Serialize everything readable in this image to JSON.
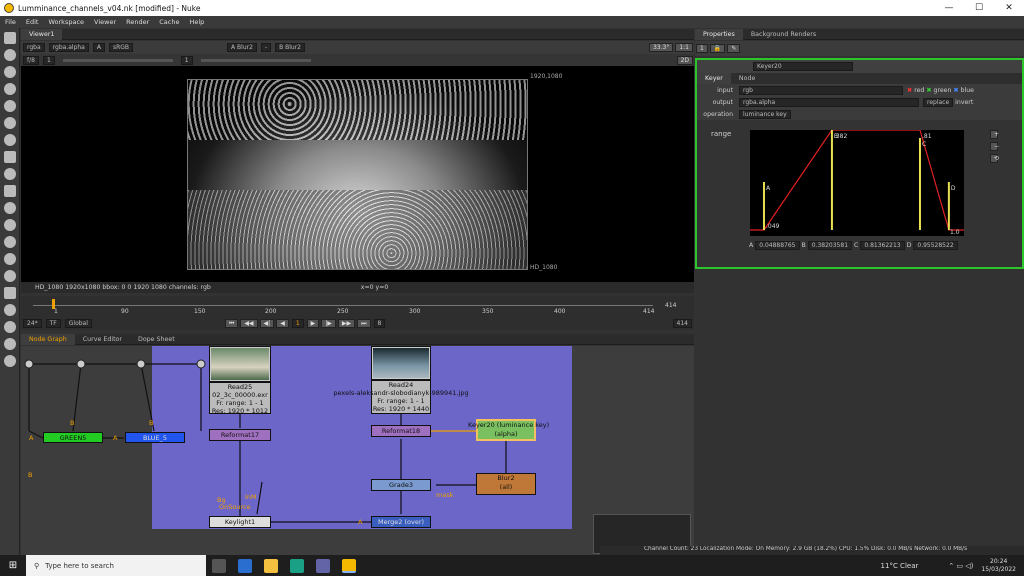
{
  "window": {
    "title": "Lumminance_channels_v04.nk [modified] - Nuke",
    "minimize": "—",
    "maximize": "☐",
    "close": "✕"
  },
  "menu": [
    "File",
    "Edit",
    "Workspace",
    "Viewer",
    "Render",
    "Cache",
    "Help"
  ],
  "viewer": {
    "tab": "Viewer1",
    "channels": "rgba",
    "channel_alpha": "rgba.alpha",
    "display": "A",
    "lut": "sRGB",
    "a_input": "A  Blur2",
    "b_input": "B  Blur2",
    "dash": "-",
    "zoom": "33.3°",
    "ratio": "1:1",
    "frame": "f/8",
    "frame_num": "1",
    "y": "1",
    "view2d": "2D",
    "format_top": "1920,1080",
    "format_bottom": "HD_1080",
    "status": "HD_1080 1920x1080  bbox: 0 0 1920 1080 channels: rgb",
    "coords": "x=0 y=0"
  },
  "timeline": {
    "ticks": [
      "1",
      "90",
      "150",
      "200",
      "250",
      "300",
      "350",
      "400",
      "414"
    ],
    "end": "414",
    "fps": "24*",
    "tf": "TF",
    "mode": "Global",
    "current": "1",
    "step": "10",
    "step2": "8",
    "end2": "414"
  },
  "graph": {
    "tabs": [
      "Node Graph",
      "Curve Editor",
      "Dope Sheet"
    ],
    "nodes": {
      "green5": "GREEN5",
      "blue5": "BLUE_5",
      "read25": [
        "Read25",
        "02_3c_00000.exr",
        "Fr. range: 1 - 1",
        "Res: 1920 * 1012"
      ],
      "read24": [
        "Read24",
        "pexels-aleksandr-slobodianyk-989941.jpg",
        "Fr. range: 1 - 1",
        "Res: 1920 * 1440"
      ],
      "reformat17": "Reformat17",
      "reformat18": "Reformat18",
      "keyer20": [
        "Keyer20 (luminance key)",
        "(alpha)"
      ],
      "grade3": "Grade3",
      "blur2": [
        "Blur2",
        "(all)"
      ],
      "keylight1": "Keylight1",
      "merge2": "Merge2 (over)",
      "mask": "mask",
      "a": "A",
      "b": "B",
      "bg": "Bg",
      "inm": "InM",
      "onsource": "OnSource"
    }
  },
  "properties": {
    "tabs": [
      "Properties",
      "Background Renders"
    ],
    "node_name": "Keyer20",
    "subtabs": [
      "Keyer",
      "Node"
    ],
    "input_label": "input",
    "input_val": "rgb",
    "red": "red",
    "green": "green",
    "blue": "blue",
    "output_label": "output",
    "output_val": "rgba.alpha",
    "op": "replace",
    "invert": "invert",
    "operation_label": "operation",
    "operation_val": "luminance key",
    "range_label": "range",
    "curve_labels": {
      "a": "A",
      "b": "B",
      "c": "C",
      "d": "D",
      "v049": ".049",
      "v382": ".382",
      "v81": ".81",
      "v1": "1.0"
    },
    "values": {
      "A": "0.04888765",
      "B": "0.38203581",
      "C": "0.81362213",
      "D": "0.95528522"
    },
    "keys": [
      "A",
      "B",
      "C",
      "D"
    ],
    "curve": {
      "A": 0.0489,
      "B": 0.382,
      "C": 0.8136,
      "D": 0.9553
    }
  },
  "status": "Channel Count: 23  Localization Mode: On  Memory: 2.9 GB (18.2%)  CPU: 1.5%  Disk: 0.0 MB/s  Network: 0.0 MB/s",
  "taskbar": {
    "search": "Type here to search",
    "weather": "11°C  Clear",
    "time": "20:24",
    "date": "15/03/2022"
  }
}
